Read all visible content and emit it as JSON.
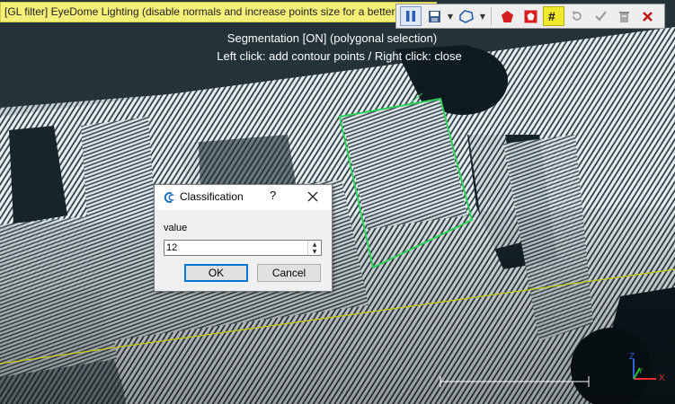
{
  "banner": {
    "text": "[GL filter] EyeDome Lighting (disable normals and increase points size for a better result!)"
  },
  "toolbar": {
    "buttons": [
      {
        "icon": "pause-icon"
      },
      {
        "icon": "save-icon"
      },
      {
        "icon": "polygon-selection-icon"
      },
      {
        "icon": "segment-in-icon"
      },
      {
        "icon": "segment-out-icon"
      },
      {
        "icon": "grid-icon"
      },
      {
        "icon": "reset-icon"
      },
      {
        "icon": "confirm-icon"
      },
      {
        "icon": "confirm-delete-icon"
      },
      {
        "icon": "cancel-icon"
      }
    ],
    "highlight_color": "#f1ea2c"
  },
  "segmentation": {
    "line1": "Segmentation [ON] (polygonal selection)",
    "line2": "Left click: add contour points / Right click: close"
  },
  "dialog": {
    "title": "Classification",
    "help": "?",
    "label": "value",
    "input_value": "12",
    "ok_label": "OK",
    "cancel_label": "Cancel",
    "accent_color": "#0078d7"
  },
  "axes": {
    "x_label": "X",
    "y_label": "Y",
    "z_label": "Z"
  },
  "colors": {
    "polygon": "#2fd05a",
    "ground_line": "#c8c800",
    "axis_x": "#e03030",
    "axis_y": "#30c030",
    "axis_z": "#3060e0"
  }
}
